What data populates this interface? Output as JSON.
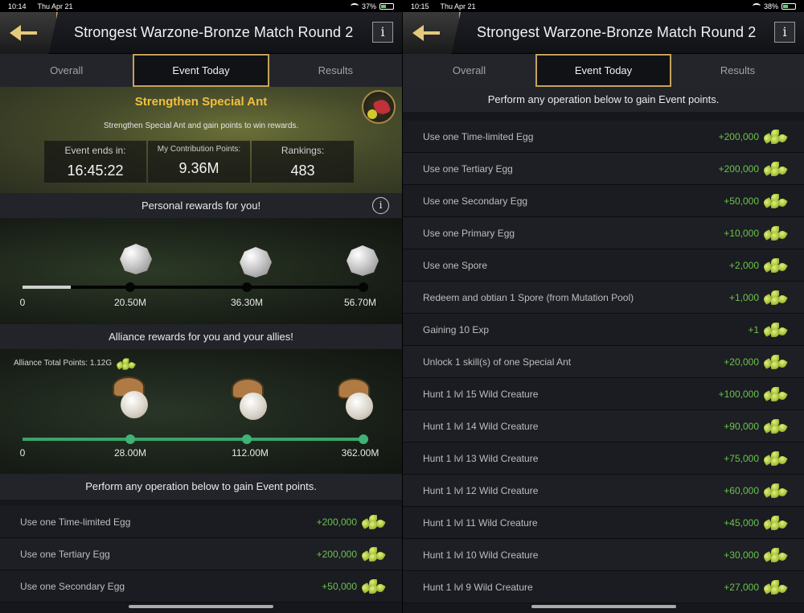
{
  "left": {
    "status": {
      "time": "10:14",
      "date": "Thu Apr 21",
      "battery": "37%"
    },
    "title": "Strongest Warzone-Bronze Match Round 2",
    "info_label": "i",
    "tabs": [
      "Overall",
      "Event Today",
      "Results"
    ],
    "event": {
      "title": "Strengthen Special Ant",
      "subtitle": "Strengthen Special Ant and gain points to win rewards.",
      "stats": [
        {
          "label": "Event ends in:",
          "value": "16:45:22"
        },
        {
          "label": "My Contribution Points:",
          "value": "9.36M"
        },
        {
          "label": "Rankings:",
          "value": "483"
        }
      ]
    },
    "personal": {
      "heading": "Personal rewards for you!",
      "progress_fraction": 0.14,
      "milestones": [
        "0",
        "20.50M",
        "36.30M",
        "56.70M"
      ]
    },
    "alliance": {
      "heading": "Alliance rewards for you and your allies!",
      "total_label": "Alliance Total Points: 1.12G",
      "milestones": [
        "0",
        "28.00M",
        "112.00M",
        "362.00M"
      ]
    },
    "operations_heading": "Perform any operation below to gain Event points.",
    "operations": [
      {
        "desc": "Use one Time-limited Egg",
        "pts": "+200,000"
      },
      {
        "desc": "Use one Tertiary Egg",
        "pts": "+200,000"
      },
      {
        "desc": "Use one Secondary Egg",
        "pts": "+50,000"
      }
    ]
  },
  "right": {
    "status": {
      "time": "10:15",
      "date": "Thu Apr 21",
      "battery": "38%"
    },
    "title": "Strongest Warzone-Bronze Match Round 2",
    "info_label": "i",
    "tabs": [
      "Overall",
      "Event Today",
      "Results"
    ],
    "operations_heading": "Perform any operation below to gain Event points.",
    "operations": [
      {
        "desc": "Use one Time-limited Egg",
        "pts": "+200,000"
      },
      {
        "desc": "Use one Tertiary Egg",
        "pts": "+200,000"
      },
      {
        "desc": "Use one Secondary Egg",
        "pts": "+50,000"
      },
      {
        "desc": "Use one Primary Egg",
        "pts": "+10,000"
      },
      {
        "desc": "Use one Spore",
        "pts": "+2,000"
      },
      {
        "desc": "Redeem and obtian 1 Spore (from Mutation Pool)",
        "pts": "+1,000"
      },
      {
        "desc": "Gaining 10 Exp",
        "pts": "+1"
      },
      {
        "desc": "Unlock 1 skill(s) of one Special Ant",
        "pts": "+20,000"
      },
      {
        "desc": "Hunt 1 lvl 15 Wild Creature",
        "pts": "+100,000"
      },
      {
        "desc": "Hunt 1 lvl 14 Wild Creature",
        "pts": "+90,000"
      },
      {
        "desc": "Hunt 1 lvl 13 Wild Creature",
        "pts": "+75,000"
      },
      {
        "desc": "Hunt 1 lvl 12 Wild Creature",
        "pts": "+60,000"
      },
      {
        "desc": "Hunt 1 lvl 11 Wild Creature",
        "pts": "+45,000"
      },
      {
        "desc": "Hunt 1 lvl 10 Wild Creature",
        "pts": "+30,000"
      },
      {
        "desc": "Hunt 1 lvl 9 Wild Creature",
        "pts": "+27,000"
      }
    ]
  }
}
